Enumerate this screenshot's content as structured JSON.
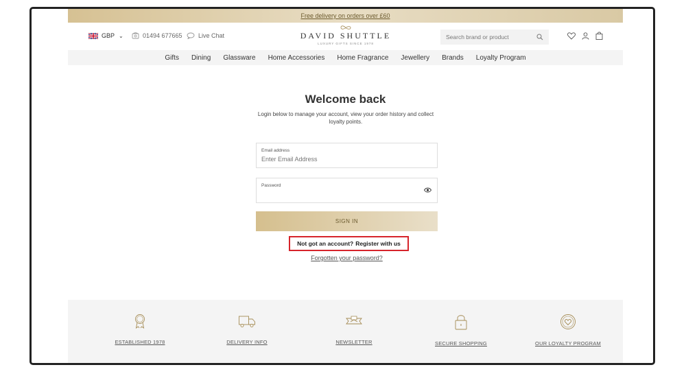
{
  "promo": {
    "text": "Free delivery on orders over £60"
  },
  "header": {
    "currency": "GBP",
    "phone": "01494 677665",
    "chat": "Live Chat",
    "logo_name": "DAVID SHUTTLE",
    "logo_tagline": "LUXURY GIFTS SINCE 1978",
    "search_placeholder": "Search brand or product"
  },
  "nav": {
    "items": [
      "Gifts",
      "Dining",
      "Glassware",
      "Home Accessories",
      "Home Fragrance",
      "Jewellery",
      "Brands",
      "Loyalty Program"
    ]
  },
  "login": {
    "title": "Welcome back",
    "intro": "Login below to manage your account, view your order history and collect loyalty points.",
    "email_label": "Email address",
    "email_placeholder": "Enter Email Address",
    "password_label": "Password",
    "signin_label": "SIGN IN",
    "register_prefix": "Not got an account?",
    "register_link": "Register with us",
    "forgot_link": "Forgotten your password?"
  },
  "footer": {
    "features": [
      "ESTABLISHED 1978",
      "DELIVERY INFO",
      "NEWSLETTER",
      "SECURE SHOPPING",
      "OUR LOYALTY PROGRAM"
    ]
  },
  "colors": {
    "gold": "#c9b27c",
    "highlight": "#d6232a"
  }
}
